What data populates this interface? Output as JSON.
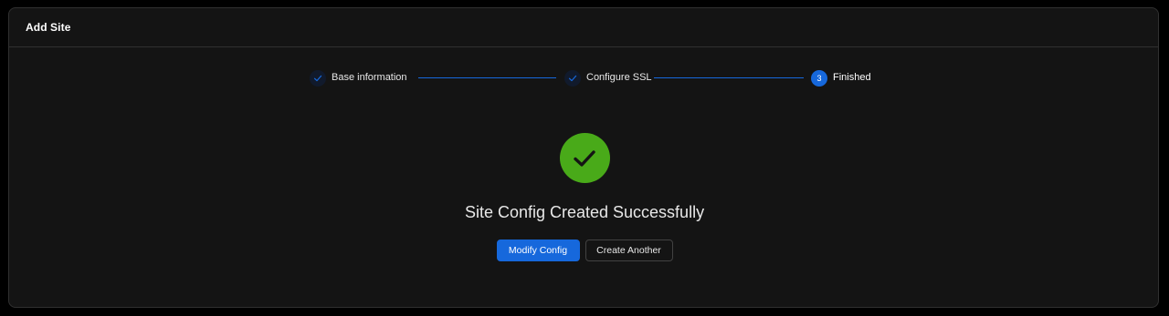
{
  "card": {
    "title": "Add Site"
  },
  "steps": [
    {
      "label": "Base information",
      "status": "finished",
      "icon": "check-icon"
    },
    {
      "label": "Configure SSL",
      "status": "finished",
      "icon": "check-icon"
    },
    {
      "label": "Finished",
      "status": "current",
      "number": "3"
    }
  ],
  "result": {
    "status": "success",
    "icon": "check-icon",
    "title": "Site Config Created Successfully"
  },
  "actions": {
    "primary_label": "Modify Config",
    "secondary_label": "Create Another"
  },
  "colors": {
    "background": "#000000",
    "card": "#141414",
    "primary": "#1668dc",
    "success": "#49aa19",
    "text": "#e8e8e8"
  }
}
